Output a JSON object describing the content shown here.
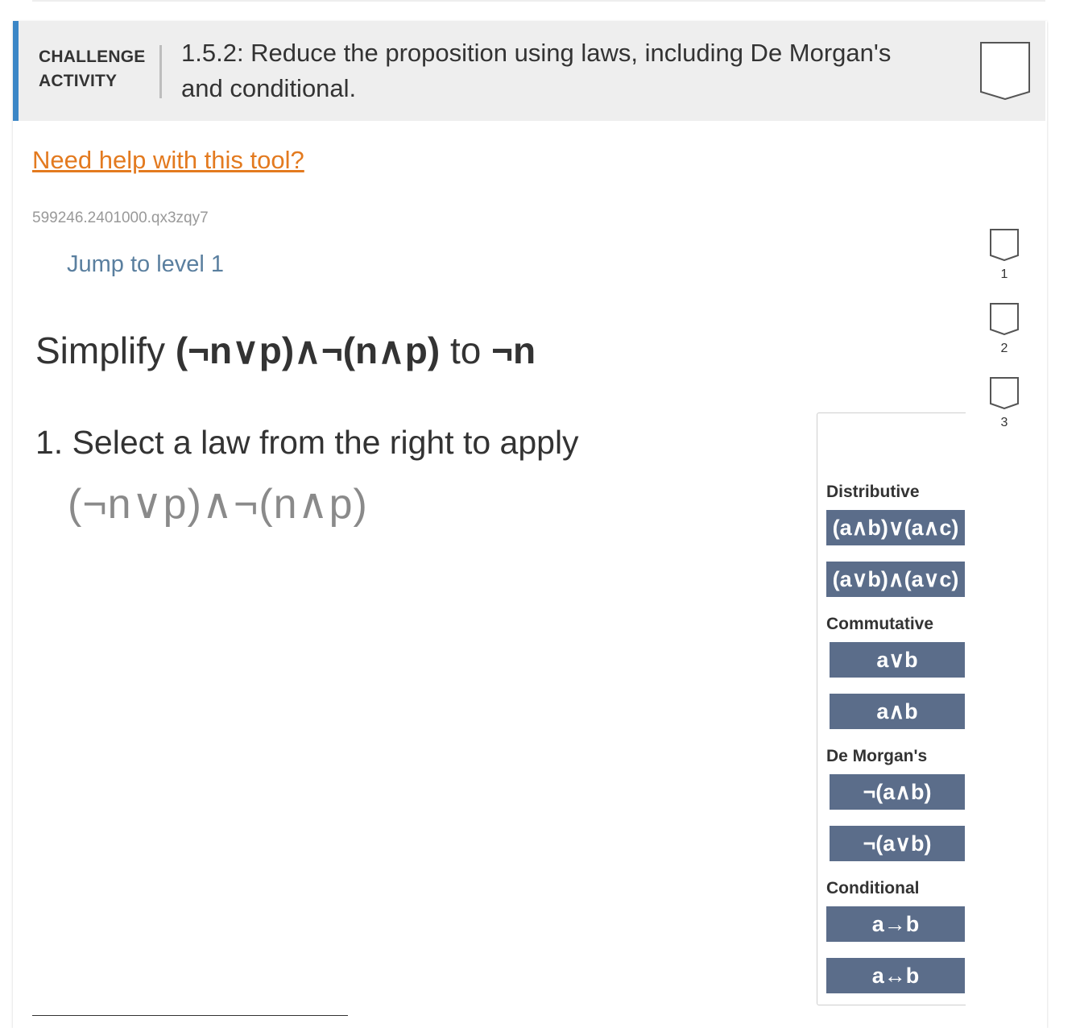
{
  "header": {
    "kind_line1": "CHALLENGE",
    "kind_line2": "ACTIVITY",
    "title": "1.5.2: Reduce the proposition using laws, including De Morgan's and conditional."
  },
  "help_link": "Need help with this tool?",
  "activity_id": "599246.2401000.qx3zqy7",
  "jump_link": "Jump to level 1",
  "levels": [
    "1",
    "2",
    "3"
  ],
  "prompt": {
    "prefix": "Simplify",
    "start_expr": "(¬n∨p)∧¬(n∧p)",
    "middle": "to",
    "target_expr": "¬n"
  },
  "step": "1. Select a law from the right to apply",
  "current_expr": "(¬n∨p)∧¬(n∧p)",
  "laws": {
    "distributive": {
      "label": "Distributive",
      "buttons": [
        "(a∧b)∨(a∧c)",
        "(a∨b)∧(a∨c)"
      ]
    },
    "commutative": {
      "label": "Commutative",
      "buttons": [
        "a∨b",
        "a∧b"
      ]
    },
    "demorgan": {
      "label": "De Morgan's",
      "buttons": [
        "¬(a∧b)",
        "¬(a∨b)"
      ]
    },
    "conditional": {
      "label": "Conditional",
      "buttons": [
        "a→b",
        "a↔b"
      ]
    }
  },
  "colors": {
    "accent_bar": "#3b86c6",
    "link_orange": "#e37a1f",
    "jump_blue": "#5a7f9f",
    "law_button": "#5b6d8a",
    "header_bg": "#eeeeee"
  }
}
